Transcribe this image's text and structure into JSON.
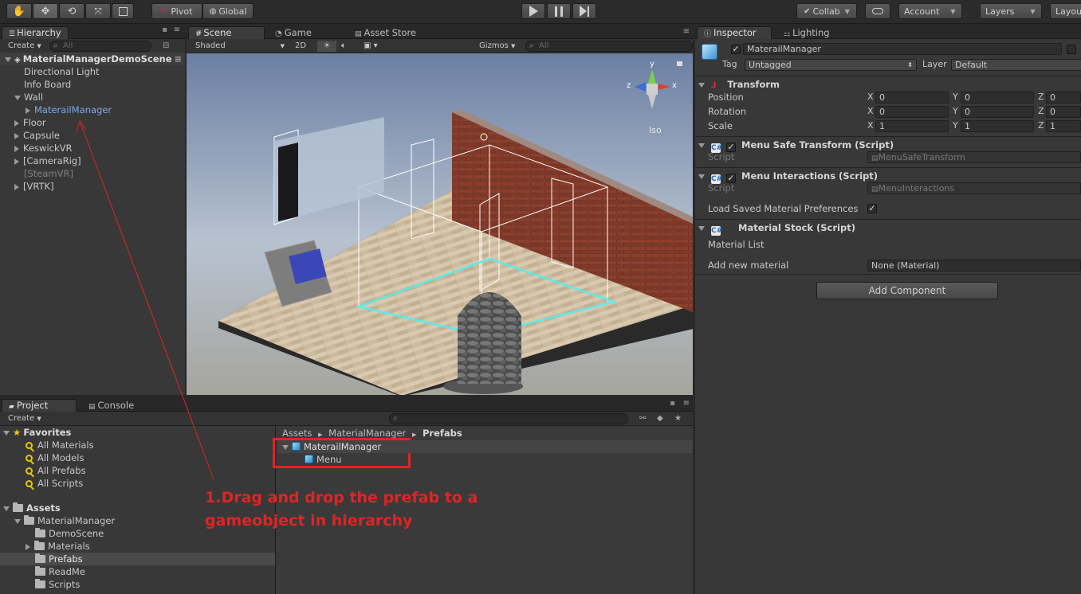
{
  "toolbar": {
    "pivot": "Pivot",
    "global": "Global",
    "collab": "Collab",
    "account": "Account",
    "layers": "Layers",
    "layout": "Layout"
  },
  "hierarchy": {
    "tab": "Hierarchy",
    "create": "Create",
    "search_placeholder": "All",
    "scene": "MaterialManagerDemoScene",
    "items": [
      {
        "label": "Directional Light"
      },
      {
        "label": "Info Board"
      },
      {
        "label": "Wall"
      },
      {
        "label": "MaterailManager"
      },
      {
        "label": "Floor"
      },
      {
        "label": "Capsule"
      },
      {
        "label": "KeswickVR"
      },
      {
        "label": "[CameraRig]"
      },
      {
        "label": "[SteamVR]"
      },
      {
        "label": "[VRTK]"
      }
    ]
  },
  "scene": {
    "tabs": [
      "Scene",
      "Game",
      "Asset Store"
    ],
    "shading": "Shaded",
    "mode_2d": "2D",
    "gizmos": "Gizmos",
    "search_placeholder": "All",
    "iso": "Iso",
    "gizmo_x": "x",
    "gizmo_y": "y",
    "gizmo_z": "z"
  },
  "project": {
    "tabs": [
      "Project",
      "Console"
    ],
    "create": "Create",
    "favorites_label": "Favorites",
    "favorites": [
      "All Materials",
      "All Models",
      "All Prefabs",
      "All Scripts"
    ],
    "assets_label": "Assets",
    "material_manager": "MaterialManager",
    "subfolders": [
      "DemoScene",
      "Materials",
      "Prefabs",
      "ReadMe",
      "Scripts"
    ],
    "breadcrumb": [
      "Assets",
      "MaterialManager",
      "Prefabs"
    ],
    "prefab_root": "MaterailManager",
    "prefab_child": "Menu"
  },
  "annotation": {
    "line1": "1.Drag and drop the prefab to a",
    "line2": "gameobject in hierarchy"
  },
  "inspector": {
    "tabs": [
      "Inspector",
      "Lighting"
    ],
    "object_name": "MaterailManager",
    "tag_label": "Tag",
    "tag_value": "Untagged",
    "layer_label": "Layer",
    "layer_value": "Default",
    "transform": {
      "title": "Transform",
      "position_label": "Position",
      "rotation_label": "Rotation",
      "scale_label": "Scale",
      "position": [
        "0",
        "0",
        "0"
      ],
      "rotation": [
        "0",
        "0",
        "0"
      ],
      "scale": [
        "1",
        "1",
        "1"
      ],
      "axes": [
        "X",
        "Y",
        "Z"
      ]
    },
    "menu_safe": {
      "title": "Menu Safe Transform (Script)",
      "script_label": "Script",
      "script_value": "MenuSafeTransform"
    },
    "menu_interactions": {
      "title": "Menu Interactions (Script)",
      "script_label": "Script",
      "script_value": "MenuInteractions",
      "load_prefs_label": "Load Saved Material Preferences"
    },
    "material_stock": {
      "title": "Material Stock (Script)",
      "list_label": "Material List",
      "add_label": "Add new material",
      "add_value": "None (Material)"
    },
    "add_component": "Add Component"
  },
  "colors": {
    "accent_blue": "#7ea8e6",
    "annotation_red": "#e02424"
  }
}
